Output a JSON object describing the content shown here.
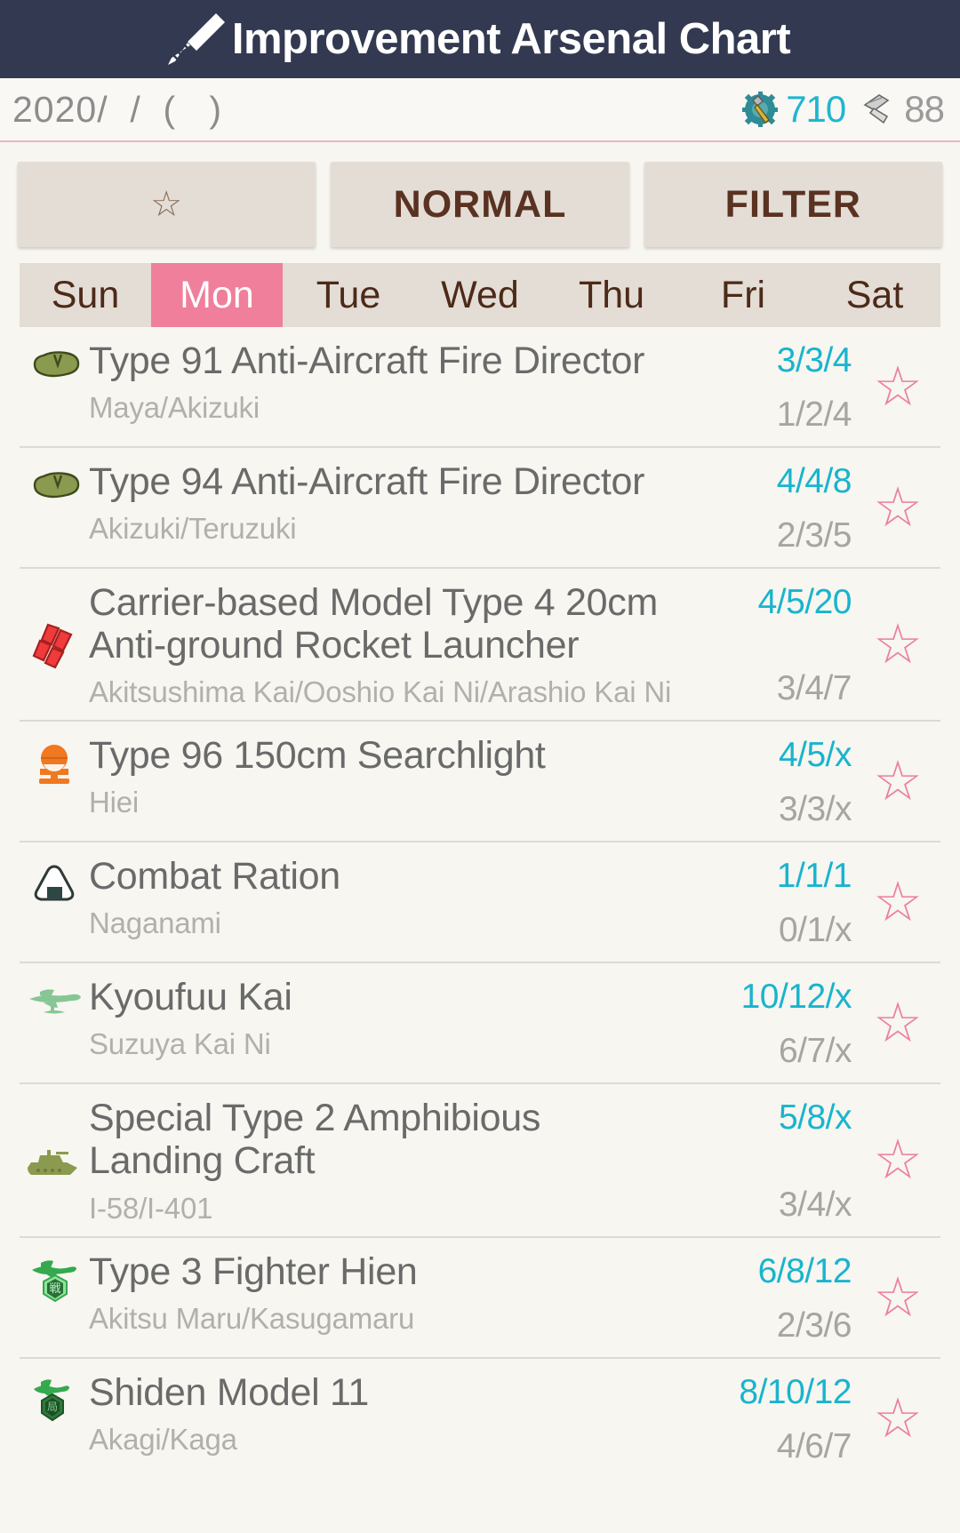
{
  "app": {
    "title": "Improvement Arsenal Chart",
    "title_icon": "screwdriver-icon",
    "bar_color": "#333950"
  },
  "datebar": {
    "date_text": "2020/  /  (   )",
    "resources": [
      {
        "icon": "development-material-icon",
        "value": "710",
        "color": "#1fb6cf"
      },
      {
        "icon": "improvement-material-icon",
        "value": "88",
        "color": "#9a9a9a"
      }
    ]
  },
  "toolbar": {
    "favorite_label": "☆",
    "mode_label": "NORMAL",
    "filter_label": "FILTER"
  },
  "weekdays": {
    "active": "Mon",
    "items": [
      "Sun",
      "Mon",
      "Tue",
      "Wed",
      "Thu",
      "Fri",
      "Sat"
    ]
  },
  "list": {
    "rows": [
      {
        "icon": "aa-fire-director-icon",
        "equipment": "Type 91 Anti-Aircraft Fire Director",
        "ships": "Maya/Akizuki",
        "upper": "3/3/4",
        "lower": "1/2/4",
        "star": "☆"
      },
      {
        "icon": "aa-fire-director-icon",
        "equipment": "Type 94 Anti-Aircraft Fire Director",
        "ships": "Akizuki/Teruzuki",
        "upper": "4/4/8",
        "lower": "2/3/5",
        "star": "☆"
      },
      {
        "icon": "rocket-launcher-icon",
        "equipment": "Carrier-based Model Type 4 20cm Anti-ground Rocket Launcher",
        "ships": "Akitsushima Kai/Ooshio Kai Ni/Arashio Kai Ni",
        "upper": "4/5/20",
        "lower": "3/4/7",
        "star": "☆"
      },
      {
        "icon": "searchlight-icon",
        "equipment": "Type 96 150cm Searchlight",
        "ships": "Hiei",
        "upper": "4/5/x",
        "lower": "3/3/x",
        "star": "☆"
      },
      {
        "icon": "combat-ration-icon",
        "equipment": "Combat Ration",
        "ships": "Naganami",
        "upper": "1/1/1",
        "lower": "0/1/x",
        "star": "☆"
      },
      {
        "icon": "seaplane-fighter-icon",
        "equipment": "Kyoufuu Kai",
        "ships": "Suzuya Kai Ni",
        "upper": "10/12/x",
        "lower": "6/7/x",
        "star": "☆"
      },
      {
        "icon": "amphibious-tank-icon",
        "equipment": "Special Type 2 Amphibious Landing Craft",
        "ships": "I-58/I-401",
        "upper": "5/8/x",
        "lower": "3/4/x",
        "star": "☆"
      },
      {
        "icon": "land-based-fighter-icon",
        "equipment": "Type 3 Fighter Hien",
        "ships": "Akitsu Maru/Kasugamaru",
        "upper": "6/8/12",
        "lower": "2/3/6",
        "star": "☆"
      },
      {
        "icon": "land-based-fighter-dark-icon",
        "equipment": "Shiden Model 11",
        "ships": "Akagi/Kaga",
        "upper": "8/10/12",
        "lower": "4/6/7",
        "star": "☆"
      }
    ]
  },
  "colors": {
    "appbar": "#333950",
    "accent_cyan": "#19b4cd",
    "accent_pink": "#ef7f9b",
    "button_bg": "#e3ddd6",
    "page_bg": "#f7f6f1"
  }
}
